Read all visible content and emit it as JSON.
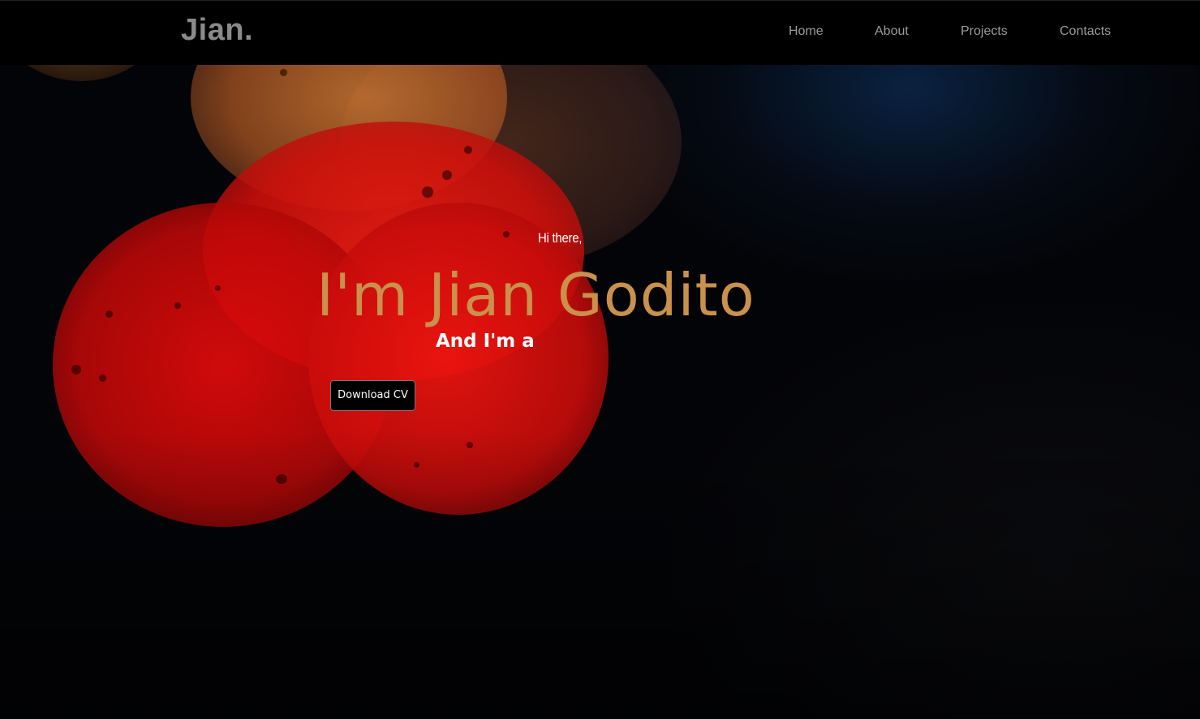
{
  "header": {
    "logo": "Jian.",
    "nav": [
      {
        "label": "Home"
      },
      {
        "label": "About"
      },
      {
        "label": "Projects"
      },
      {
        "label": "Contacts"
      }
    ]
  },
  "hero": {
    "greeting": "Hi there,",
    "headline": "I'm Jian Godito",
    "subheadline": "And I'm a",
    "cta_label": "Download CV"
  },
  "colors": {
    "header_bg": "#000000",
    "logo": "#8a8a8a",
    "nav_text": "#9a9a9a",
    "headline_accent": "#c9914b",
    "text_primary": "#ffffff",
    "button_bg": "#000000"
  }
}
